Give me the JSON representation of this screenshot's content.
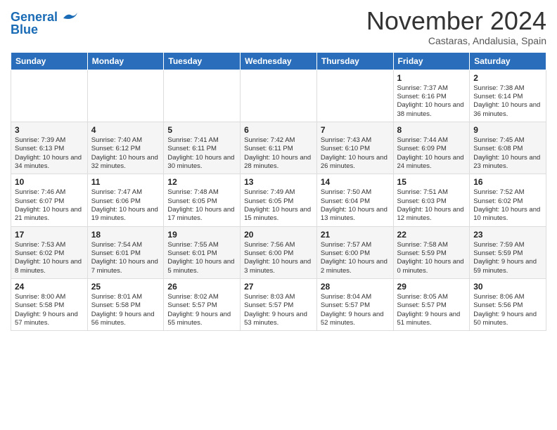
{
  "header": {
    "logo_line1": "General",
    "logo_line2": "Blue",
    "month": "November 2024",
    "location": "Castaras, Andalusia, Spain"
  },
  "days_of_week": [
    "Sunday",
    "Monday",
    "Tuesday",
    "Wednesday",
    "Thursday",
    "Friday",
    "Saturday"
  ],
  "weeks": [
    [
      {
        "day": "",
        "text": ""
      },
      {
        "day": "",
        "text": ""
      },
      {
        "day": "",
        "text": ""
      },
      {
        "day": "",
        "text": ""
      },
      {
        "day": "",
        "text": ""
      },
      {
        "day": "1",
        "text": "Sunrise: 7:37 AM\nSunset: 6:16 PM\nDaylight: 10 hours and 38 minutes."
      },
      {
        "day": "2",
        "text": "Sunrise: 7:38 AM\nSunset: 6:14 PM\nDaylight: 10 hours and 36 minutes."
      }
    ],
    [
      {
        "day": "3",
        "text": "Sunrise: 7:39 AM\nSunset: 6:13 PM\nDaylight: 10 hours and 34 minutes."
      },
      {
        "day": "4",
        "text": "Sunrise: 7:40 AM\nSunset: 6:12 PM\nDaylight: 10 hours and 32 minutes."
      },
      {
        "day": "5",
        "text": "Sunrise: 7:41 AM\nSunset: 6:11 PM\nDaylight: 10 hours and 30 minutes."
      },
      {
        "day": "6",
        "text": "Sunrise: 7:42 AM\nSunset: 6:11 PM\nDaylight: 10 hours and 28 minutes."
      },
      {
        "day": "7",
        "text": "Sunrise: 7:43 AM\nSunset: 6:10 PM\nDaylight: 10 hours and 26 minutes."
      },
      {
        "day": "8",
        "text": "Sunrise: 7:44 AM\nSunset: 6:09 PM\nDaylight: 10 hours and 24 minutes."
      },
      {
        "day": "9",
        "text": "Sunrise: 7:45 AM\nSunset: 6:08 PM\nDaylight: 10 hours and 23 minutes."
      }
    ],
    [
      {
        "day": "10",
        "text": "Sunrise: 7:46 AM\nSunset: 6:07 PM\nDaylight: 10 hours and 21 minutes."
      },
      {
        "day": "11",
        "text": "Sunrise: 7:47 AM\nSunset: 6:06 PM\nDaylight: 10 hours and 19 minutes."
      },
      {
        "day": "12",
        "text": "Sunrise: 7:48 AM\nSunset: 6:05 PM\nDaylight: 10 hours and 17 minutes."
      },
      {
        "day": "13",
        "text": "Sunrise: 7:49 AM\nSunset: 6:05 PM\nDaylight: 10 hours and 15 minutes."
      },
      {
        "day": "14",
        "text": "Sunrise: 7:50 AM\nSunset: 6:04 PM\nDaylight: 10 hours and 13 minutes."
      },
      {
        "day": "15",
        "text": "Sunrise: 7:51 AM\nSunset: 6:03 PM\nDaylight: 10 hours and 12 minutes."
      },
      {
        "day": "16",
        "text": "Sunrise: 7:52 AM\nSunset: 6:02 PM\nDaylight: 10 hours and 10 minutes."
      }
    ],
    [
      {
        "day": "17",
        "text": "Sunrise: 7:53 AM\nSunset: 6:02 PM\nDaylight: 10 hours and 8 minutes."
      },
      {
        "day": "18",
        "text": "Sunrise: 7:54 AM\nSunset: 6:01 PM\nDaylight: 10 hours and 7 minutes."
      },
      {
        "day": "19",
        "text": "Sunrise: 7:55 AM\nSunset: 6:01 PM\nDaylight: 10 hours and 5 minutes."
      },
      {
        "day": "20",
        "text": "Sunrise: 7:56 AM\nSunset: 6:00 PM\nDaylight: 10 hours and 3 minutes."
      },
      {
        "day": "21",
        "text": "Sunrise: 7:57 AM\nSunset: 6:00 PM\nDaylight: 10 hours and 2 minutes."
      },
      {
        "day": "22",
        "text": "Sunrise: 7:58 AM\nSunset: 5:59 PM\nDaylight: 10 hours and 0 minutes."
      },
      {
        "day": "23",
        "text": "Sunrise: 7:59 AM\nSunset: 5:59 PM\nDaylight: 9 hours and 59 minutes."
      }
    ],
    [
      {
        "day": "24",
        "text": "Sunrise: 8:00 AM\nSunset: 5:58 PM\nDaylight: 9 hours and 57 minutes."
      },
      {
        "day": "25",
        "text": "Sunrise: 8:01 AM\nSunset: 5:58 PM\nDaylight: 9 hours and 56 minutes."
      },
      {
        "day": "26",
        "text": "Sunrise: 8:02 AM\nSunset: 5:57 PM\nDaylight: 9 hours and 55 minutes."
      },
      {
        "day": "27",
        "text": "Sunrise: 8:03 AM\nSunset: 5:57 PM\nDaylight: 9 hours and 53 minutes."
      },
      {
        "day": "28",
        "text": "Sunrise: 8:04 AM\nSunset: 5:57 PM\nDaylight: 9 hours and 52 minutes."
      },
      {
        "day": "29",
        "text": "Sunrise: 8:05 AM\nSunset: 5:57 PM\nDaylight: 9 hours and 51 minutes."
      },
      {
        "day": "30",
        "text": "Sunrise: 8:06 AM\nSunset: 5:56 PM\nDaylight: 9 hours and 50 minutes."
      }
    ]
  ]
}
